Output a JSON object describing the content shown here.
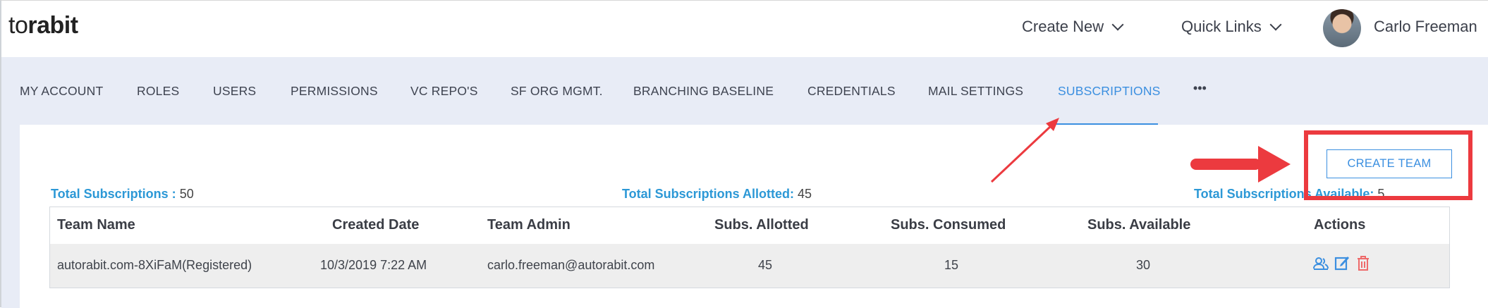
{
  "header": {
    "logo_light": "to",
    "logo_bold": "rabit",
    "create_new": "Create New",
    "quick_links": "Quick Links",
    "user_name": "Carlo Freeman"
  },
  "tabs": [
    {
      "label": "MY ACCOUNT"
    },
    {
      "label": "ROLES"
    },
    {
      "label": "USERS"
    },
    {
      "label": "PERMISSIONS"
    },
    {
      "label": "VC REPO'S"
    },
    {
      "label": "SF ORG MGMT."
    },
    {
      "label": "BRANCHING BASELINE"
    },
    {
      "label": "CREDENTIALS"
    },
    {
      "label": "MAIL SETTINGS"
    },
    {
      "label": "SUBSCRIPTIONS",
      "active": true
    },
    {
      "label": "•••"
    }
  ],
  "actions": {
    "create_team": "CREATE TEAM"
  },
  "stats": {
    "total_label": "Total Subscriptions :",
    "total_value": "50",
    "allotted_label": "Total Subscriptions Allotted:",
    "allotted_value": "45",
    "available_label": "Total Subscriptions Available:",
    "available_value": "5"
  },
  "table": {
    "headers": [
      "Team Name",
      "Created Date",
      "Team Admin",
      "Subs. Allotted",
      "Subs. Consumed",
      "Subs. Available",
      "Actions"
    ],
    "rows": [
      [
        "autorabit.com-8XiFaM(Registered)",
        "10/3/2019 7:22 AM",
        "carlo.freeman@autorabit.com",
        "45",
        "15",
        "30"
      ]
    ]
  },
  "colors": {
    "accent": "#3b8fe0",
    "stat_label": "#2c98d6",
    "annotation": "#ec3a3f",
    "nav_bg": "#e8ecf6",
    "delete": "#ee6a6a"
  },
  "icons": {
    "chevron": "chevron-down-icon",
    "row_actions": [
      "user-group-icon",
      "edit-icon",
      "trash-icon"
    ]
  }
}
